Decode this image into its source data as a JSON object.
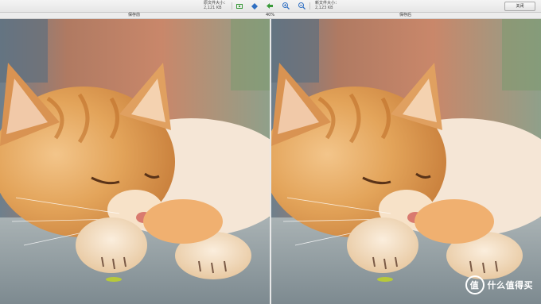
{
  "toolbar": {
    "original_size_label": "原文件大小：",
    "original_size_value": "2,121 KB",
    "new_size_label": "新文件大小：",
    "new_size_value": "2,123 KB",
    "close_label": "关闭",
    "buttons": [
      "fit-icon",
      "actual-size-icon",
      "back-arrow-icon",
      "zoom-in-icon",
      "zoom-out-icon"
    ]
  },
  "labels": {
    "before": "保存前",
    "zoom": "40%",
    "after": "保存后"
  },
  "watermark": {
    "logo": "值",
    "text": "什么值得买"
  },
  "colors": {
    "toolbar_bg": "#ececec",
    "icon_green": "#3a9a3a",
    "icon_blue": "#2f6fc2"
  }
}
